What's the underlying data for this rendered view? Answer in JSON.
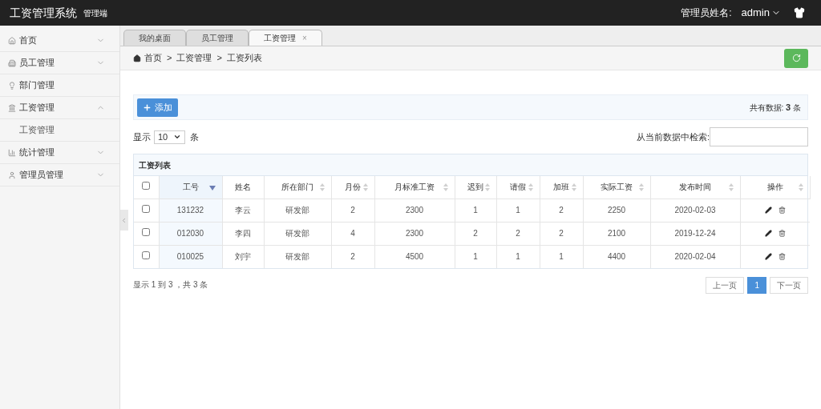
{
  "header": {
    "title": "工资管理系统",
    "subtitle": "管理端",
    "user_label": "管理员姓名:",
    "user_name": "admin"
  },
  "sidebar": {
    "items": [
      {
        "label": "首页",
        "kind": "menu",
        "expanded": false
      },
      {
        "label": "员工管理",
        "kind": "menu",
        "expanded": false
      },
      {
        "label": "部门管理",
        "kind": "link"
      },
      {
        "label": "工资管理",
        "kind": "menu",
        "expanded": true,
        "children": [
          {
            "label": "工资管理"
          }
        ]
      },
      {
        "label": "统计管理",
        "kind": "menu",
        "expanded": false
      },
      {
        "label": "管理员管理",
        "kind": "menu",
        "expanded": false
      }
    ]
  },
  "tabs": [
    {
      "label": "我的桌面",
      "selected": false,
      "closable": false
    },
    {
      "label": "员工管理",
      "selected": false,
      "closable": false
    },
    {
      "label": "工资管理",
      "selected": true,
      "closable": true,
      "close": "×"
    }
  ],
  "breadcrumb": [
    "首页",
    "工资管理",
    "工资列表"
  ],
  "breadcrumb_separator": ">",
  "toolbar": {
    "add_button": "添加",
    "total_label": "共有数据:",
    "total_count": "3",
    "total_unit": "条"
  },
  "page_size": {
    "prefix": "显示",
    "value": "10",
    "suffix": "条"
  },
  "search": {
    "label": "从当前数据中检索:"
  },
  "table": {
    "title": "工资列表",
    "select_all_checked": false,
    "columns": [
      {
        "label": "工号",
        "sortable": true,
        "sorted": true
      },
      {
        "label": "姓名",
        "sortable": false,
        "sorted": false
      },
      {
        "label": "所在部门",
        "sortable": true,
        "sorted": false
      },
      {
        "label": "月份",
        "sortable": true,
        "sorted": false
      },
      {
        "label": "月标准工资",
        "sortable": true,
        "sorted": false
      },
      {
        "label": "迟到",
        "sortable": true,
        "sorted": false
      },
      {
        "label": "请假",
        "sortable": true,
        "sorted": false
      },
      {
        "label": "加班",
        "sortable": true,
        "sorted": false
      },
      {
        "label": "实际工资",
        "sortable": true,
        "sorted": false
      },
      {
        "label": "发布时间",
        "sortable": true,
        "sorted": false
      },
      {
        "label": "操作",
        "sortable": true,
        "sorted": false
      }
    ],
    "rows": [
      {
        "checked": false,
        "cells": [
          "131232",
          "李云",
          "研发部",
          "2",
          "2300",
          "1",
          "1",
          "2",
          "2250",
          "2020-02-03"
        ]
      },
      {
        "checked": false,
        "cells": [
          "012030",
          "李四",
          "研发部",
          "4",
          "2300",
          "2",
          "2",
          "2",
          "2100",
          "2019-12-24"
        ]
      },
      {
        "checked": false,
        "cells": [
          "010025",
          "刘宇",
          "研发部",
          "2",
          "4500",
          "1",
          "1",
          "1",
          "4400",
          "2020-02-04"
        ]
      }
    ]
  },
  "info": "显示 1 到 3 ，共 3 条",
  "pagination": [
    {
      "label": "上一页",
      "selected": false
    },
    {
      "label": "1",
      "selected": true
    },
    {
      "label": "下一页",
      "selected": false
    }
  ]
}
